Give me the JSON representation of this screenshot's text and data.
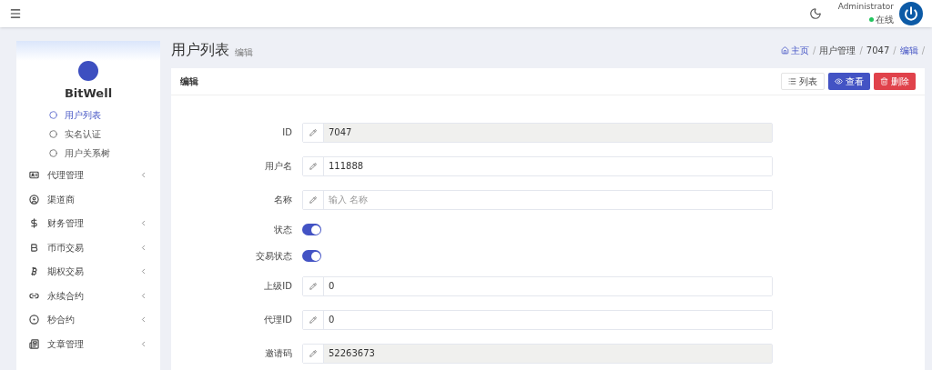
{
  "header": {
    "user": "Administrator",
    "status": "在线"
  },
  "sidebar": {
    "brand": "BitWell",
    "subitems": [
      {
        "label": "用户列表",
        "selected": true
      },
      {
        "label": "实名认证",
        "selected": false
      },
      {
        "label": "用户关系树",
        "selected": false
      }
    ],
    "items": [
      {
        "label": "代理管理",
        "expandable": true
      },
      {
        "label": "渠道商",
        "expandable": false
      },
      {
        "label": "财务管理",
        "expandable": true
      },
      {
        "label": "币币交易",
        "expandable": true
      },
      {
        "label": "期权交易",
        "expandable": true
      },
      {
        "label": "永续合约",
        "expandable": true
      },
      {
        "label": "秒合约",
        "expandable": true
      },
      {
        "label": "文章管理",
        "expandable": true
      }
    ]
  },
  "page": {
    "title": "用户列表",
    "subtitle": "编辑",
    "breadcrumb": [
      "主页",
      "用户管理",
      "7047",
      "编辑"
    ],
    "separator": "/"
  },
  "card": {
    "title": "编辑",
    "buttons": [
      {
        "kind": "list",
        "label": "列表"
      },
      {
        "kind": "view",
        "label": "查看"
      },
      {
        "kind": "delete",
        "label": "删除"
      }
    ],
    "fields": [
      {
        "kind": "text",
        "label": "ID",
        "value": "7047",
        "readonly": true
      },
      {
        "kind": "text",
        "label": "用户名",
        "value": "111888",
        "readonly": false
      },
      {
        "kind": "text",
        "label": "名称",
        "placeholder": "输入 名称",
        "readonly": false
      },
      {
        "kind": "switch",
        "label": "状态",
        "on": true
      },
      {
        "kind": "switch",
        "label": "交易状态",
        "on": true
      },
      {
        "kind": "text",
        "label": "上级ID",
        "value": "0",
        "readonly": false
      },
      {
        "kind": "text",
        "label": "代理ID",
        "value": "0",
        "readonly": false
      },
      {
        "kind": "text",
        "label": "邀请码",
        "value": "52263673",
        "readonly": true
      }
    ]
  }
}
